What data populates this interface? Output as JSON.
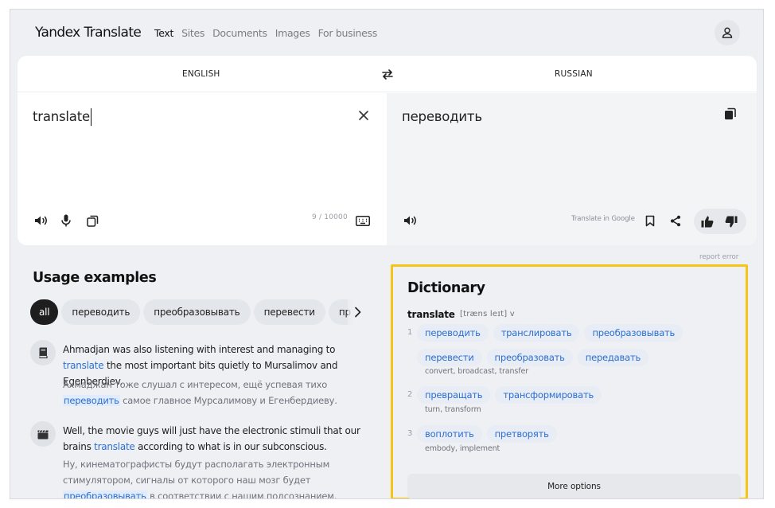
{
  "header": {
    "logo": "Yandex Translate",
    "nav": [
      "Text",
      "Sites",
      "Documents",
      "Images",
      "For business"
    ],
    "active_nav": "Text"
  },
  "translator": {
    "source_lang": "ENGLISH",
    "target_lang": "RUSSIAN",
    "source_text": "translate",
    "target_text": "переводить",
    "char_counter": "9 / 10000",
    "translate_in_google": "Translate in Google",
    "report_error": "report error"
  },
  "usage": {
    "title": "Usage examples",
    "chips": [
      "all",
      "переводить",
      "преобразовывать",
      "перевести",
      "пр"
    ],
    "active_chip": "all",
    "examples": [
      {
        "icon": "book-icon",
        "en_before": "Ahmadjan was also listening with interest and managing to ",
        "en_highlight": "translate",
        "en_after": " the most important bits quietly to Mursalimov and Egenberdiev.",
        "ru_before": "Ахмаджан тоже слушал с интересом, ещё успевая тихо ",
        "ru_highlight": "переводить",
        "ru_after": " самое главное Мурсалимову и Егенбердиеву."
      },
      {
        "icon": "clapperboard-icon",
        "en_before": "Well, the movie guys will just have the electronic stimuli that our brains ",
        "en_highlight": "translate",
        "en_after": " according to what is in our subconscious.",
        "ru_before": "Ну, кинематографисты будут располагать электронным стимулятором, сигналы от которого наш мозг будет ",
        "ru_highlight": "преобразовывать",
        "ru_after": " в соответствии с нашим подсознанием."
      }
    ]
  },
  "dictionary": {
    "title": "Dictionary",
    "word": "translate",
    "transcription": "[træns leɪt] v",
    "senses": [
      {
        "num": "1",
        "translations": [
          "переводить",
          "транслировать",
          "преобразовывать",
          "перевести",
          "преобразовать",
          "передавать"
        ],
        "synonyms": "convert, broadcast, transfer"
      },
      {
        "num": "2",
        "translations": [
          "превращать",
          "трансформировать"
        ],
        "synonyms": "turn, transform"
      },
      {
        "num": "3",
        "translations": [
          "воплотить",
          "претворять"
        ],
        "synonyms": "embody, implement"
      }
    ],
    "more_options": "More options"
  },
  "colors": {
    "accent": "#2c6fd1",
    "highlight_border": "#f5c518",
    "background": "#eef0f4"
  }
}
